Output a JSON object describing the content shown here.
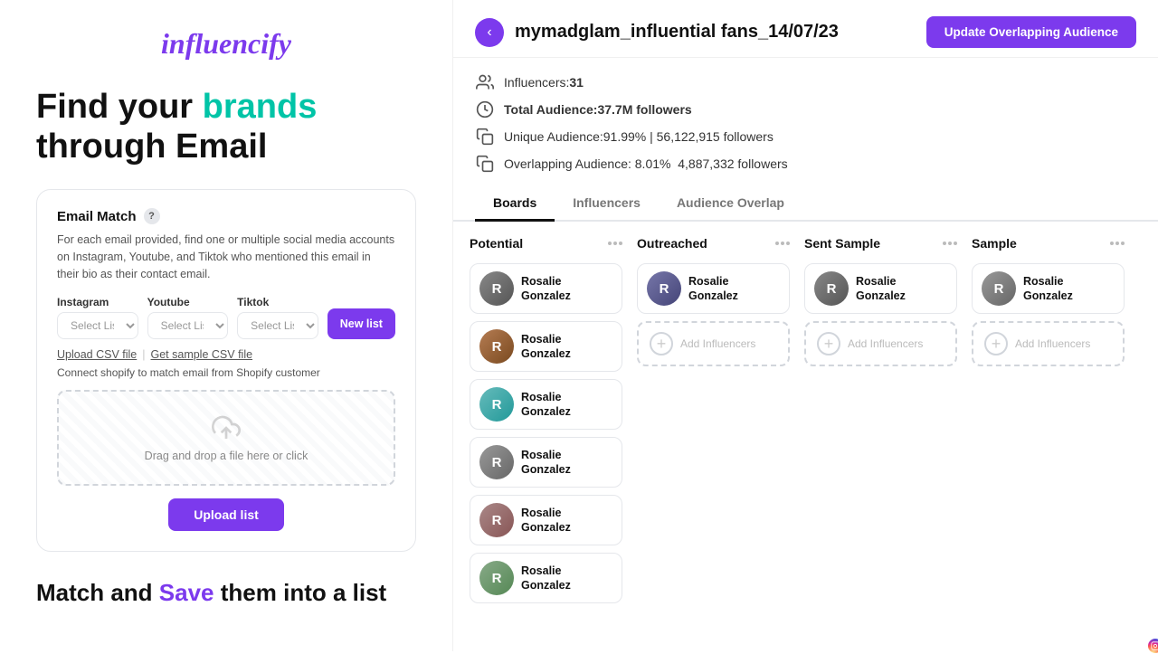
{
  "left": {
    "logo": "influencify",
    "headline_part1": "Find your ",
    "headline_accent": "brands",
    "headline_part2": " through Email",
    "card": {
      "title": "Email Match",
      "help": "?",
      "description": "For each email provided, find one or multiple social media accounts on Instagram, Youtube, and Tiktok who mentioned this email in their bio as their contact email.",
      "platforms": [
        {
          "label": "Instagram",
          "placeholder": "Select List"
        },
        {
          "label": "Youtube",
          "placeholder": "Select List"
        },
        {
          "label": "Tiktok",
          "placeholder": "Select List"
        }
      ],
      "new_list_btn": "New list",
      "upload_csv_label": "Upload CSV file",
      "sample_csv_label": "Get sample CSV file",
      "shopify_text": "Connect shopify to match email from Shopify customer",
      "dropzone_text": "Drag and drop a file here or click",
      "upload_btn": "Upload list"
    },
    "bottom_headline_part1": "Match and ",
    "bottom_headline_accent": "Save",
    "bottom_headline_part2": " them into a list"
  },
  "right": {
    "back_icon": "‹",
    "page_title": "mymadglam_influential fans_14/07/23",
    "update_btn": "Update Overlapping Audience",
    "stats": [
      {
        "icon": "👥",
        "text": "Influencers:",
        "value": "31",
        "bold": false
      },
      {
        "icon": "🕐",
        "text": "Total Audience:",
        "value": "37.7M followers",
        "bold": true
      },
      {
        "icon": "📋",
        "text": "Unique Audience:",
        "value": "91.99% | 56,122,915 followers",
        "bold": false
      },
      {
        "icon": "📋",
        "text": "Overlapping Audience: 8.01%",
        "value": " 4,887,332 followers",
        "bold": false
      }
    ],
    "tabs": [
      {
        "label": "Boards",
        "active": true
      },
      {
        "label": "Influencers",
        "active": false
      },
      {
        "label": "Audience Overlap",
        "active": false
      }
    ],
    "boards": [
      {
        "title": "Potential",
        "influencers": [
          {
            "name": "Rosalie Gonzalez",
            "color": "c1"
          },
          {
            "name": "Rosalie Gonzalez",
            "color": "c2"
          },
          {
            "name": "Rosalie Gonzalez",
            "color": "c3"
          },
          {
            "name": "Rosalie Gonzalez",
            "color": "c4"
          },
          {
            "name": "Rosalie Gonzalez",
            "color": "c5"
          },
          {
            "name": "Rosalie Gonzalez",
            "color": "c6"
          }
        ],
        "has_add": false
      },
      {
        "title": "Outreached",
        "influencers": [
          {
            "name": "Rosalie Gonzalez",
            "color": "c7"
          }
        ],
        "has_add": true
      },
      {
        "title": "Sent Sample",
        "influencers": [
          {
            "name": "Rosalie Gonzalez",
            "color": "c1"
          }
        ],
        "has_add": true
      },
      {
        "title": "Sample",
        "influencers": [
          {
            "name": "Rosalie Gonzalez",
            "color": "c4"
          }
        ],
        "has_add": true
      }
    ],
    "add_influencer_label": "Add Influencers"
  }
}
